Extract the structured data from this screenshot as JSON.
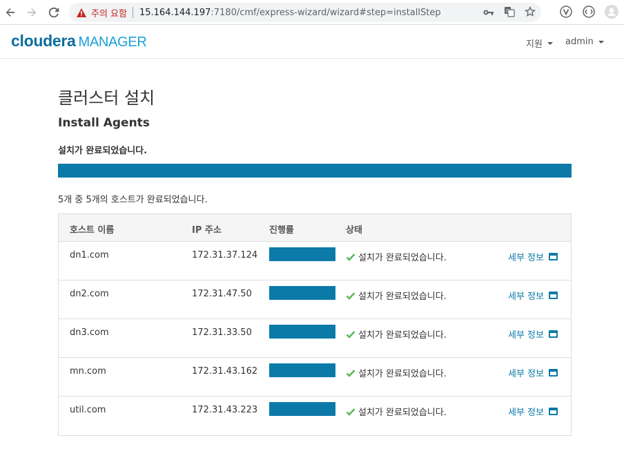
{
  "browser": {
    "security_warning": "주의 요함",
    "url_host": "15.164.144.197",
    "url_rest": ":7180/cmf/express-wizard/wizard#step=installStep",
    "icons": [
      "back-icon",
      "forward-icon",
      "reload-icon",
      "warning-icon",
      "key-icon",
      "translate-icon",
      "star-icon",
      "extension-icon",
      "avatar-icon"
    ]
  },
  "header": {
    "logo_main": "cloudera",
    "logo_sub": "MANAGER",
    "support_label": "지원",
    "user_label": "admin"
  },
  "page": {
    "title": "클러스터 설치",
    "step_title": "Install Agents",
    "status_message": "설치가 완료되었습니다.",
    "overall_progress": 1.0,
    "summary": "5개 중 5개의 호스트가 완료되었습니다."
  },
  "table": {
    "columns": [
      "호스트 이름",
      "IP 주소",
      "진행률",
      "상태"
    ],
    "rows": [
      {
        "host": "dn1.com",
        "ip": "172.31.37.124",
        "progress": 1.0,
        "status": "설치가 완료되었습니다.",
        "detail": "세부 정보"
      },
      {
        "host": "dn2.com",
        "ip": "172.31.47.50",
        "progress": 1.0,
        "status": "설치가 완료되었습니다.",
        "detail": "세부 정보"
      },
      {
        "host": "dn3.com",
        "ip": "172.31.33.50",
        "progress": 1.0,
        "status": "설치가 완료되었습니다.",
        "detail": "세부 정보"
      },
      {
        "host": "mn.com",
        "ip": "172.31.43.162",
        "progress": 1.0,
        "status": "설치가 완료되었습니다.",
        "detail": "세부 정보"
      },
      {
        "host": "util.com",
        "ip": "172.31.43.223",
        "progress": 1.0,
        "status": "설치가 완료되었습니다.",
        "detail": "세부 정보"
      }
    ]
  },
  "colors": {
    "accent": "#0b7aa9",
    "success": "#5cb85c",
    "warning": "#c5221f"
  }
}
